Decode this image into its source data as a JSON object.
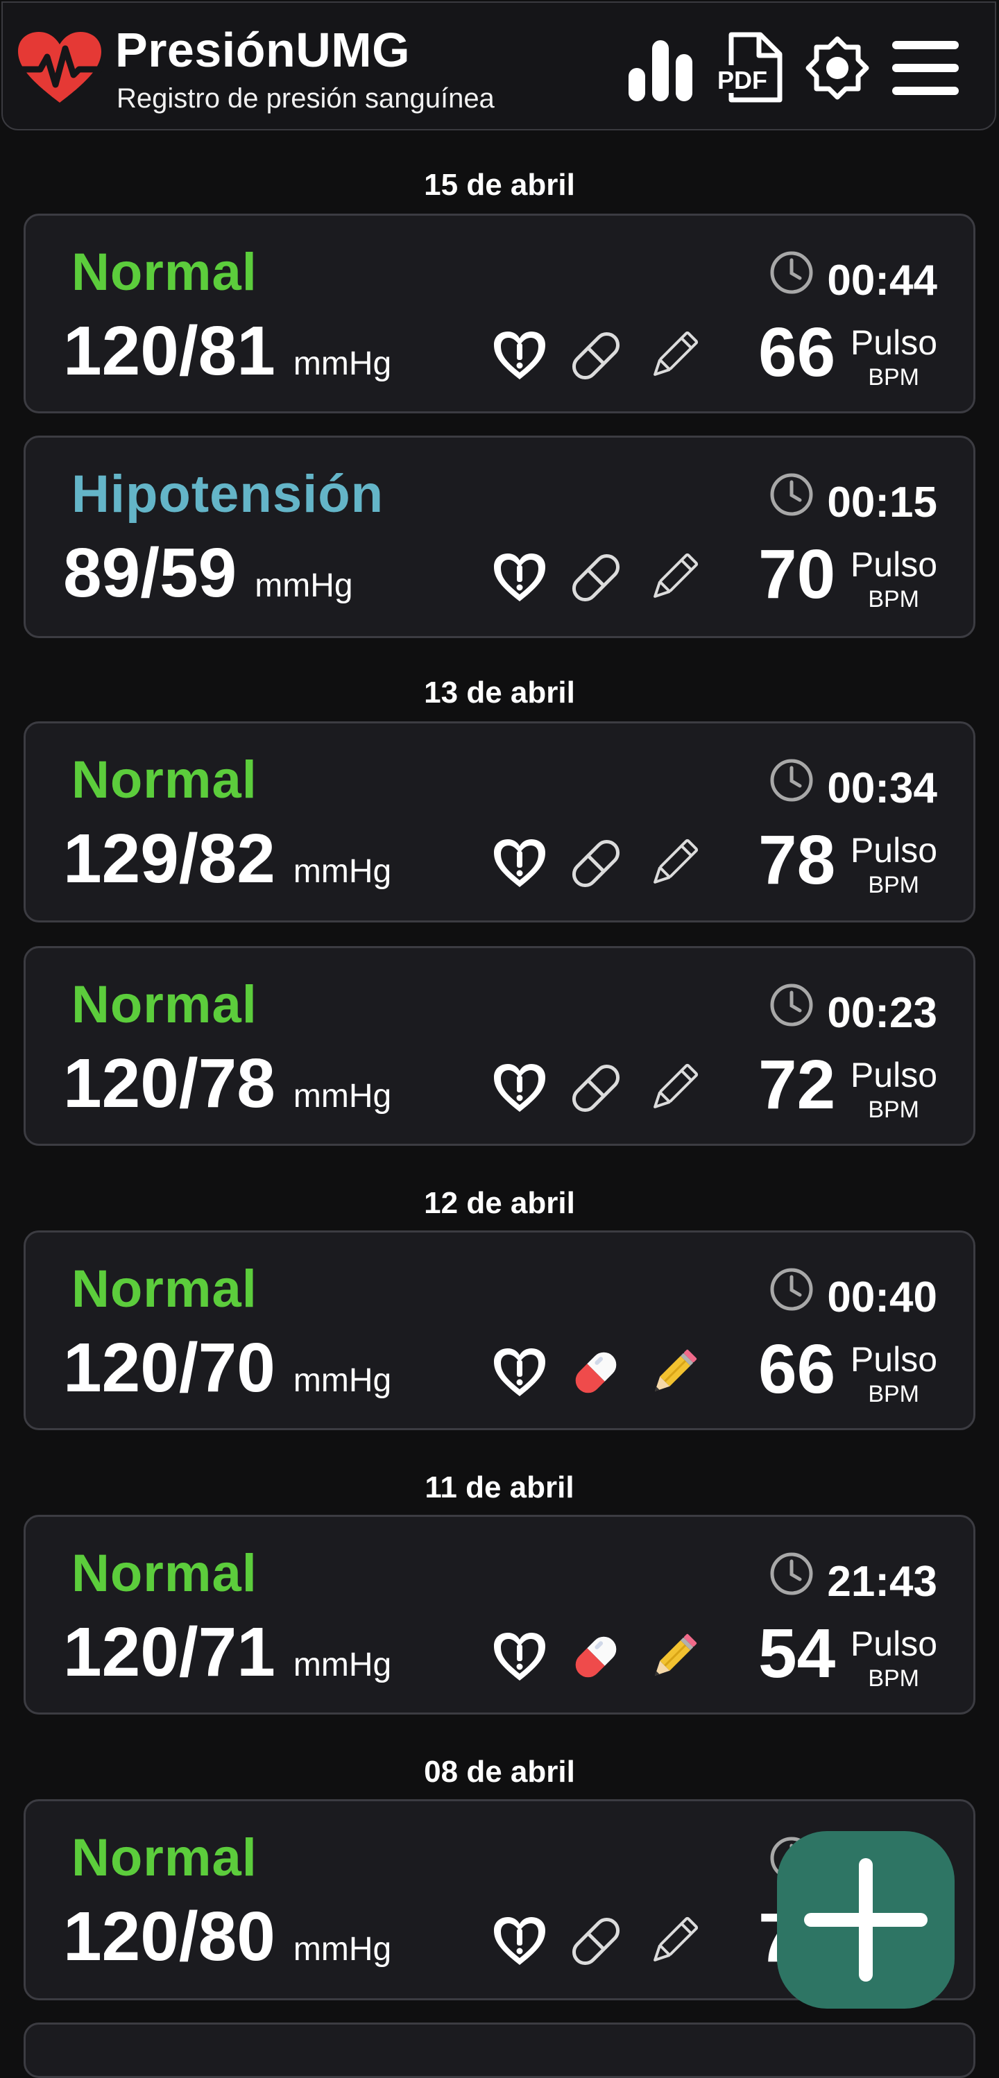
{
  "header": {
    "title": "PresiónUMG",
    "subtitle": "Registro de presión sanguínea",
    "pdf_label": "PDF"
  },
  "colors": {
    "normal": "#5ccd3c",
    "hipotension": "#64b5c8",
    "brand_red": "#e53935",
    "fab": "#2e7564"
  },
  "groups": [
    {
      "date": "15 de abril",
      "entries": [
        {
          "status": "Normal",
          "status_kind": "normal",
          "reading": "120/81",
          "unit": "mmHg",
          "time": "00:44",
          "pulse": "66",
          "pulse_label": "Pulso",
          "bpm_label": "BPM",
          "has_medication": false,
          "has_note": false
        },
        {
          "status": "Hipotensión",
          "status_kind": "hipotension",
          "reading": "89/59",
          "unit": "mmHg",
          "time": "00:15",
          "pulse": "70",
          "pulse_label": "Pulso",
          "bpm_label": "BPM",
          "has_medication": false,
          "has_note": false
        }
      ]
    },
    {
      "date": "13 de abril",
      "entries": [
        {
          "status": "Normal",
          "status_kind": "normal",
          "reading": "129/82",
          "unit": "mmHg",
          "time": "00:34",
          "pulse": "78",
          "pulse_label": "Pulso",
          "bpm_label": "BPM",
          "has_medication": false,
          "has_note": false
        },
        {
          "status": "Normal",
          "status_kind": "normal",
          "reading": "120/78",
          "unit": "mmHg",
          "time": "00:23",
          "pulse": "72",
          "pulse_label": "Pulso",
          "bpm_label": "BPM",
          "has_medication": false,
          "has_note": false
        }
      ]
    },
    {
      "date": "12 de abril",
      "entries": [
        {
          "status": "Normal",
          "status_kind": "normal",
          "reading": "120/70",
          "unit": "mmHg",
          "time": "00:40",
          "pulse": "66",
          "pulse_label": "Pulso",
          "bpm_label": "BPM",
          "has_medication": true,
          "has_note": true
        }
      ]
    },
    {
      "date": "11 de abril",
      "entries": [
        {
          "status": "Normal",
          "status_kind": "normal",
          "reading": "120/71",
          "unit": "mmHg",
          "time": "21:43",
          "pulse": "54",
          "pulse_label": "Pulso",
          "bpm_label": "BPM",
          "has_medication": true,
          "has_note": true
        }
      ]
    },
    {
      "date": "08 de abril",
      "entries": [
        {
          "status": "Normal",
          "status_kind": "normal",
          "reading": "120/80",
          "unit": "mmHg",
          "time": "",
          "pulse": "7",
          "pulse_label": "",
          "bpm_label": "",
          "has_medication": false,
          "has_note": false
        }
      ]
    }
  ],
  "icons": {
    "logo": "heart-pulse-icon",
    "stats": "bar-chart-icon",
    "pdf": "pdf-file-icon",
    "theme": "brightness-icon",
    "menu": "hamburger-menu-icon",
    "symptom": "heart-alert-icon",
    "medication": "pill-icon",
    "note": "pencil-icon",
    "time": "clock-icon",
    "add": "plus-icon"
  }
}
